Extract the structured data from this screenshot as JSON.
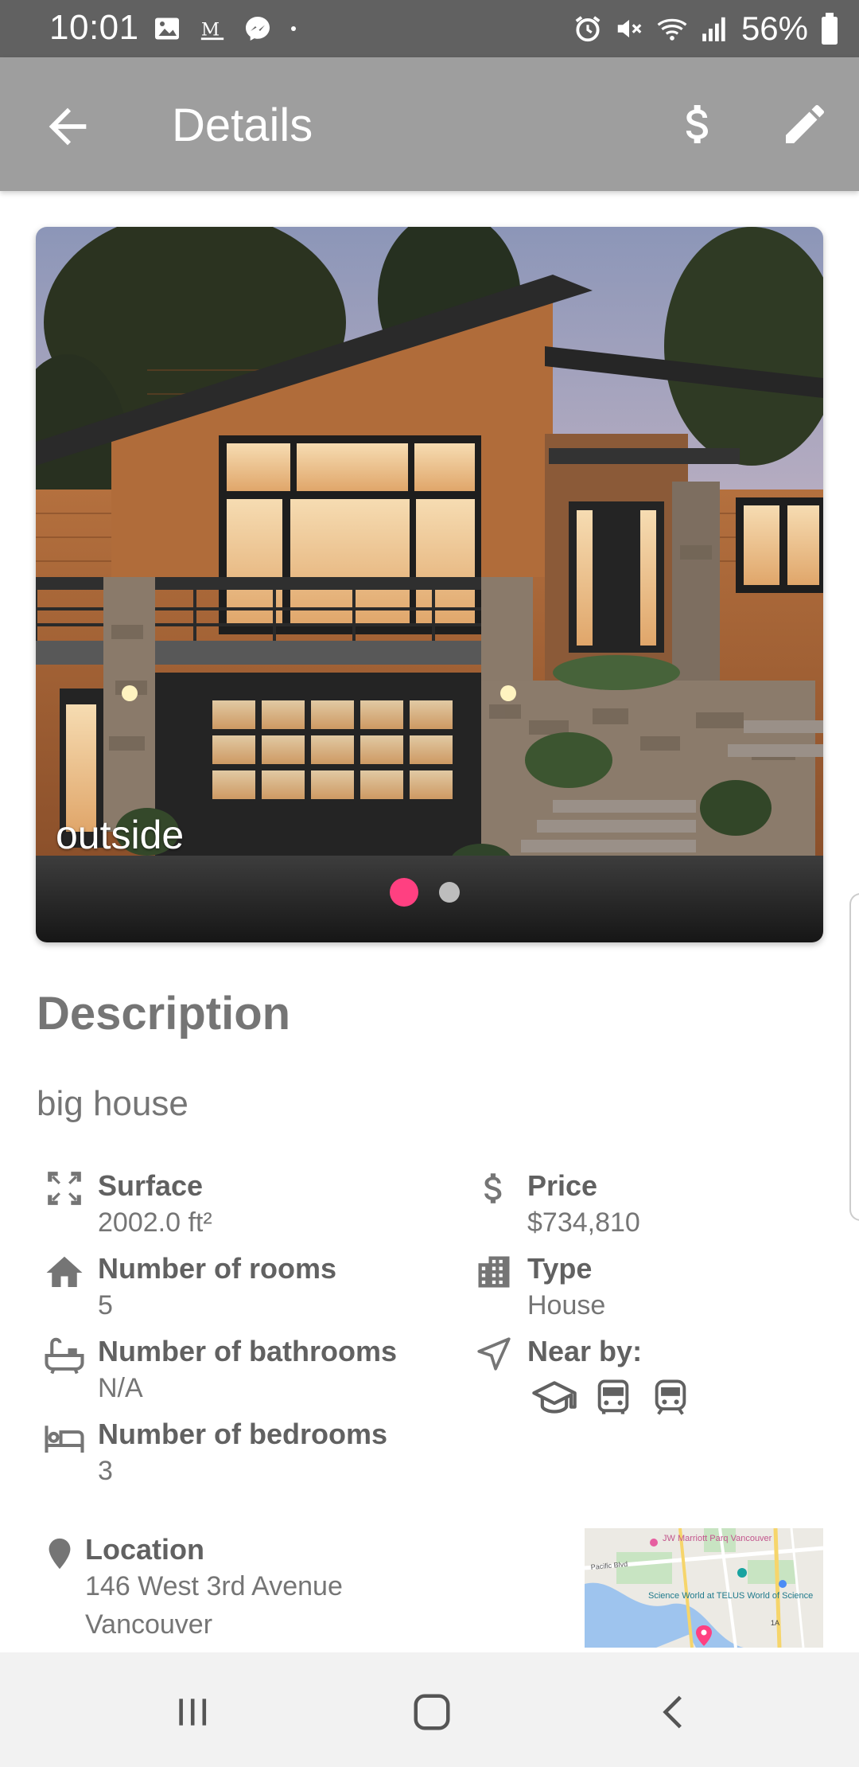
{
  "status_bar": {
    "time": "10:01",
    "battery": "56%",
    "left_icons": [
      "image-icon",
      "email-icon",
      "messenger-icon",
      "dot-icon"
    ],
    "right_icons": [
      "alarm-icon",
      "mute-icon",
      "wifi-icon",
      "signal-icon",
      "battery-icon"
    ]
  },
  "app_bar": {
    "title": "Details",
    "actions": [
      "back-arrow-icon",
      "dollar-icon",
      "edit-pencil-icon"
    ]
  },
  "gallery": {
    "caption": "outside",
    "page_count": 2,
    "active_page": 1
  },
  "description": {
    "title": "Description",
    "text": "big house"
  },
  "attributes": {
    "surface": {
      "label": "Surface",
      "value": "2002.0 ft²"
    },
    "rooms": {
      "label": "Number of rooms",
      "value": "5"
    },
    "bathrooms": {
      "label": "Number of bathrooms",
      "value": "N/A"
    },
    "bedrooms": {
      "label": "Number of bedrooms",
      "value": "3"
    },
    "price": {
      "label": "Price",
      "value": "$734,810"
    },
    "type": {
      "label": "Type",
      "value": "House"
    },
    "near_by": {
      "label": "Near by:",
      "icons": [
        "school-icon",
        "bus-icon",
        "train-icon"
      ]
    }
  },
  "location": {
    "label": "Location",
    "line1": "146 West 3rd Avenue",
    "line2": "Vancouver",
    "map_labels": {
      "hotel": "JW Marriott Parq Vancouver",
      "street": "Pacific Blvd",
      "museum": "Science World at TELUS World of Science",
      "route": "1A"
    }
  },
  "colors": {
    "status_bar": "#616161",
    "app_bar": "#9e9e9e",
    "accent": "#ff4081",
    "text": "#757575",
    "nav_bar": "#f2f2f2"
  }
}
